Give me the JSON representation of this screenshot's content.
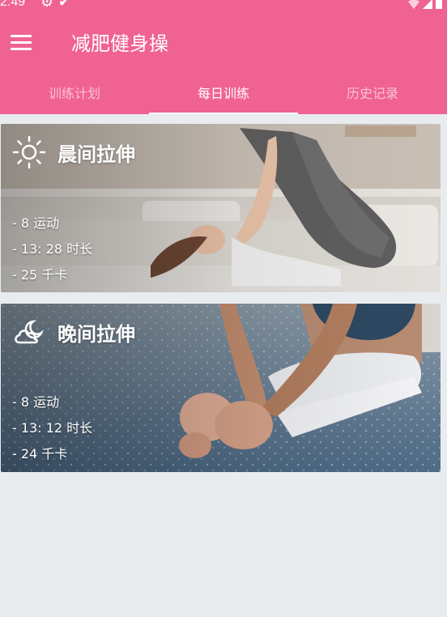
{
  "status_bar": {
    "time": "2:49"
  },
  "app_bar": {
    "title": "减肥健身操"
  },
  "tabs": [
    {
      "label": "训练计划"
    },
    {
      "label": "每日训练"
    },
    {
      "label": "历史记录"
    }
  ],
  "selected_tab": "每日训练",
  "cards": [
    {
      "title": "晨间拉伸",
      "icon": "sun-icon",
      "stats": [
        "- 8 运动",
        "- 13: 28 时长",
        "- 25 千卡"
      ]
    },
    {
      "title": "晚间拉伸",
      "icon": "moon-cloud-icon",
      "stats": [
        "- 8 运动",
        "- 13: 12 时长",
        "- 24 千卡"
      ]
    }
  ],
  "colors": {
    "primary": "#f06292",
    "background": "#e8ecef"
  }
}
